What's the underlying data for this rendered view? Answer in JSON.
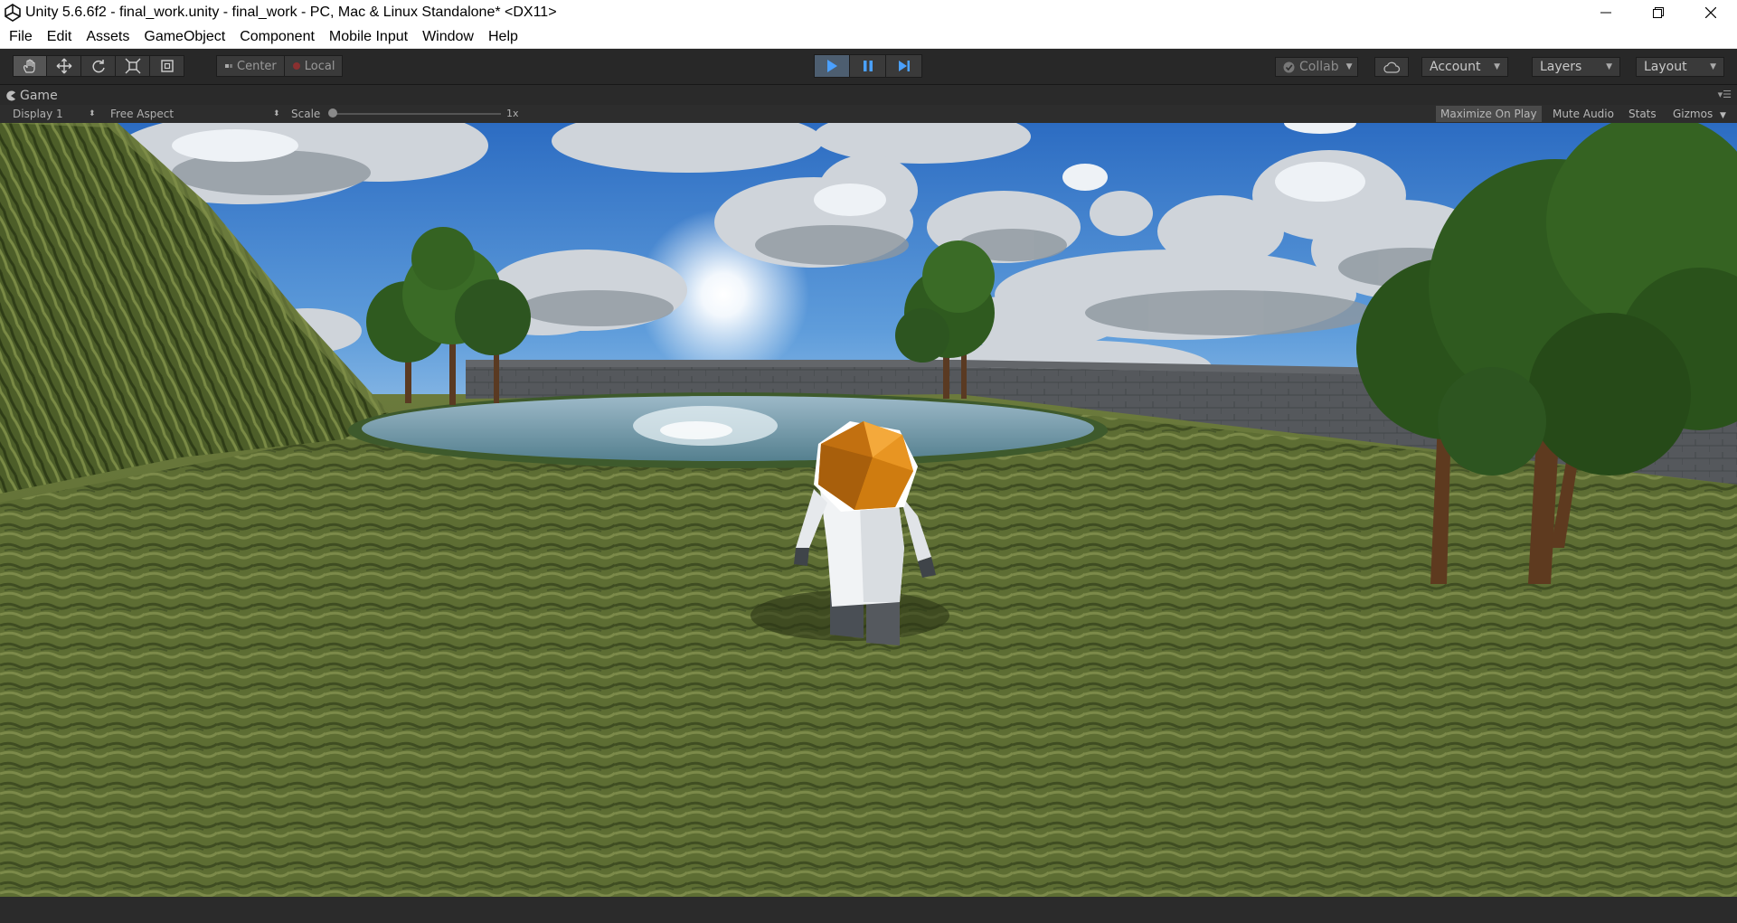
{
  "window": {
    "title": "Unity 5.6.6f2 - final_work.unity - final_work - PC, Mac & Linux Standalone* <DX11>"
  },
  "menu": {
    "items": [
      "File",
      "Edit",
      "Assets",
      "GameObject",
      "Component",
      "Mobile Input",
      "Window",
      "Help"
    ]
  },
  "toolbar": {
    "pivot_label": "Center",
    "space_label": "Local",
    "collab_label": "Collab",
    "account_label": "Account",
    "layers_label": "Layers",
    "layout_label": "Layout",
    "play_state": "playing"
  },
  "game_panel": {
    "tab_label": "Game",
    "display_label": "Display 1",
    "aspect_label": "Free Aspect",
    "scale_label": "Scale",
    "scale_value": "1x",
    "maximize_label": "Maximize On Play",
    "mute_label": "Mute Audio",
    "stats_label": "Stats",
    "gizmos_label": "Gizmos"
  },
  "colors": {
    "sky_top": "#2f6fc4",
    "sky_bottom": "#9cc6ec",
    "grass": "#5a6b33",
    "water": "#7fa8bd",
    "wall": "#5b5d60",
    "tree": "#2f5a1f",
    "helmet": "#e08a12",
    "play_accent": "#4aa0ff"
  }
}
